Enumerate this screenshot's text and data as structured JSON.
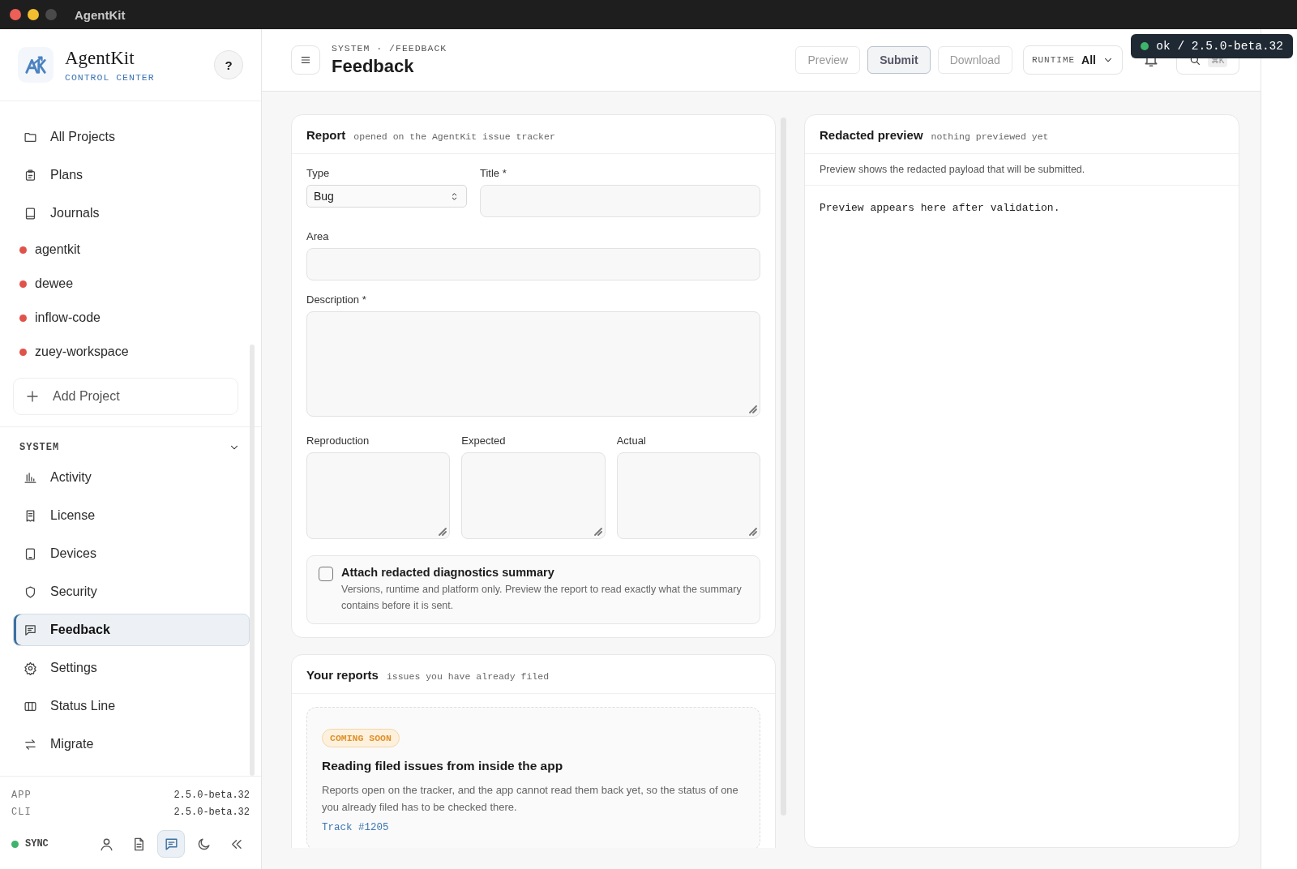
{
  "window": {
    "title": "AgentKit"
  },
  "brand": {
    "name": "AgentKit",
    "subtitle": "CONTROL CENTER",
    "help": "?"
  },
  "sidebar": {
    "links": [
      {
        "label": "All Projects",
        "selected": false
      },
      {
        "label": "Plans",
        "selected": false
      },
      {
        "label": "Journals",
        "selected": false
      }
    ],
    "projects": [
      {
        "name": "agentkit",
        "color": "#e0524a"
      },
      {
        "name": "dewee",
        "color": "#e0524a"
      },
      {
        "name": "inflow-code",
        "color": "#e0524a"
      },
      {
        "name": "zuey-workspace",
        "color": "#e0524a"
      }
    ],
    "add_project": "Add Project",
    "system": {
      "title": "SYSTEM",
      "expanded": true,
      "items": [
        {
          "label": "Activity",
          "selected": false
        },
        {
          "label": "License",
          "selected": false
        },
        {
          "label": "Devices",
          "selected": false
        },
        {
          "label": "Security",
          "selected": false
        },
        {
          "label": "Feedback",
          "selected": true
        },
        {
          "label": "Settings",
          "selected": false
        },
        {
          "label": "Status Line",
          "selected": false
        },
        {
          "label": "Migrate",
          "selected": false
        }
      ]
    },
    "versions": [
      {
        "label": "APP",
        "value": "2.5.0-beta.32"
      },
      {
        "label": "CLI",
        "value": "2.5.0-beta.32"
      }
    ],
    "sync": {
      "label": "SYNC",
      "color": "#3fb36b"
    },
    "footer_buttons": [
      {
        "selected": false
      },
      {
        "selected": false
      },
      {
        "selected": true
      },
      {
        "selected": false
      },
      {
        "selected": false
      }
    ]
  },
  "header": {
    "breadcrumb": "SYSTEM · /FEEDBACK",
    "title": "Feedback",
    "actions": [
      {
        "label": "Preview",
        "selected": false
      },
      {
        "label": "Submit",
        "selected": true
      },
      {
        "label": "Download",
        "selected": false
      }
    ],
    "runtime": {
      "label": "RUNTIME",
      "value": "All"
    },
    "search_shortcut": "⌘K",
    "toast": {
      "text": "ok / 2.5.0-beta.32",
      "color": "#3fb36b"
    }
  },
  "report": {
    "title": "Report",
    "subtitle": "opened on the AgentKit issue tracker",
    "type": {
      "label": "Type",
      "value": "Bug"
    },
    "title_field": {
      "label": "Title *"
    },
    "area": {
      "label": "Area"
    },
    "description": {
      "label": "Description *"
    },
    "details": [
      {
        "label": "Reproduction"
      },
      {
        "label": "Expected"
      },
      {
        "label": "Actual"
      }
    ],
    "diagnostics": {
      "label": "Attach redacted diagnostics summary",
      "description": "Versions, runtime and platform only. Preview the report to read exactly what the summary contains before it is sent.",
      "checked": false
    }
  },
  "preview": {
    "title": "Redacted preview",
    "subtitle": "nothing previewed yet",
    "note": "Preview shows the redacted payload that will be submitted.",
    "body": "Preview appears here after validation."
  },
  "your_reports": {
    "title": "Your reports",
    "subtitle": "issues you have already filed",
    "notice": {
      "badge": "COMING SOON",
      "title": "Reading filed issues from inside the app",
      "text": "Reports open on the tracker, and the app cannot read them back yet, so the status of one you already filed has to be checked there.",
      "link": "Track #1205"
    }
  }
}
